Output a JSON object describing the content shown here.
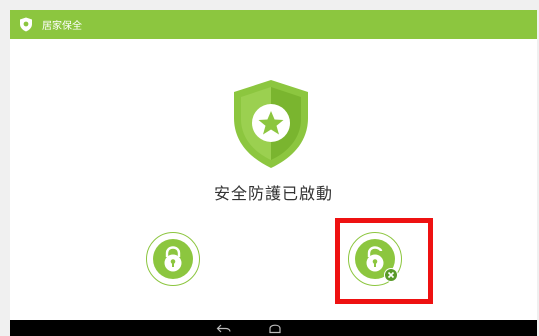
{
  "app": {
    "title": "居家保全",
    "accent_color": "#8cc63f",
    "icon": "shield-icon"
  },
  "main": {
    "shield_icon": "shield-star-icon",
    "status_text": "安全防護已啟動"
  },
  "actions": {
    "lock": {
      "icon": "lock-icon"
    },
    "unlock": {
      "icon": "unlock-remove-icon",
      "highlighted": true,
      "highlight_color": "#ee1111"
    }
  },
  "navbar": {
    "back_icon": "back-icon",
    "home_icon": "home-icon"
  }
}
